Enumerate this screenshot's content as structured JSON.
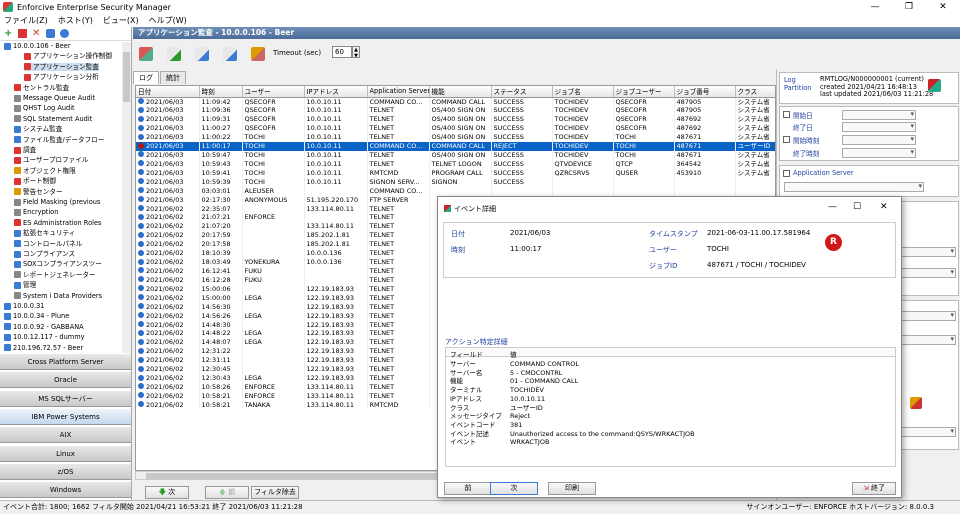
{
  "window": {
    "title": "Enforcive Enterprise Security Manager",
    "controls": [
      "—",
      "❐",
      "✕"
    ]
  },
  "menu": [
    "ファイル(Z)",
    "ホスト(Y)",
    "ビュー(X)",
    "ヘルプ(W)"
  ],
  "tree": {
    "items": [
      {
        "label": "10.0.0.106 - Beer",
        "level": 0,
        "color": "#3a7bd5"
      },
      {
        "label": "アプリケーション操作制御",
        "level": 2,
        "color": "#d33"
      },
      {
        "label": "アプリケーション監査",
        "level": 2,
        "color": "#d33"
      },
      {
        "label": "アプリケーション分析",
        "level": 2,
        "color": "#d33"
      },
      {
        "label": "セントラル監査",
        "level": 1,
        "color": "#d33"
      },
      {
        "label": "Message Queue Audit",
        "level": 1,
        "color": "#888"
      },
      {
        "label": "QHST Log Audit",
        "level": 1,
        "color": "#888"
      },
      {
        "label": "SQL Statement Audit",
        "level": 1,
        "color": "#888"
      },
      {
        "label": "システム監査",
        "level": 1,
        "color": "#3a7bd5"
      },
      {
        "label": "ファイル監査/データフロー",
        "level": 1,
        "color": "#3a7bd5"
      },
      {
        "label": "調査",
        "level": 1,
        "color": "#d33"
      },
      {
        "label": "ユーザープロファイル",
        "level": 1,
        "color": "#d33"
      },
      {
        "label": "オブジェクト権限",
        "level": 1,
        "color": "#d90"
      },
      {
        "label": "ポート制御",
        "level": 1,
        "color": "#d33"
      },
      {
        "label": "警告センター",
        "level": 1,
        "color": "#d90"
      },
      {
        "label": "Field Masking (previous",
        "level": 1,
        "color": "#888"
      },
      {
        "label": "Encryption",
        "level": 1,
        "color": "#888"
      },
      {
        "label": "ES Administration Roles",
        "level": 1,
        "color": "#d33"
      },
      {
        "label": "拡張セキュリティ",
        "level": 1,
        "color": "#3a7bd5"
      },
      {
        "label": "コントロールパネル",
        "level": 1,
        "color": "#3a7bd5"
      },
      {
        "label": "コンプライアンス",
        "level": 1,
        "color": "#3a7bd5"
      },
      {
        "label": "SOXコンプライアンスツー",
        "level": 1,
        "color": "#3a7bd5"
      },
      {
        "label": "レポートジェネレーター",
        "level": 1,
        "color": "#888"
      },
      {
        "label": "管理",
        "level": 1,
        "color": "#3a7bd5"
      },
      {
        "label": "System i Data Providers",
        "level": 1,
        "color": "#888"
      },
      {
        "label": "10.0.0.31",
        "level": 0,
        "color": "#3a7bd5"
      },
      {
        "label": "10.0.0.34 - Plune",
        "level": 0,
        "color": "#3a7bd5"
      },
      {
        "label": "10.0.0.92 - GABBANA",
        "level": 0,
        "color": "#3a7bd5"
      },
      {
        "label": "10.0.12.117 - dummy",
        "level": 0,
        "color": "#3a7bd5"
      },
      {
        "label": "210.196.72.57 - Beer",
        "level": 0,
        "color": "#3a7bd5"
      }
    ]
  },
  "nav_buttons": [
    {
      "label": "Cross Platform Server",
      "active": false
    },
    {
      "label": "Oracle",
      "active": false
    },
    {
      "label": "MS SQLサーバー",
      "active": false
    },
    {
      "label": "IBM Power Systems",
      "active": true
    },
    {
      "label": "AIX",
      "active": false
    },
    {
      "label": "Linux",
      "active": false
    },
    {
      "label": "z/OS",
      "active": false
    },
    {
      "label": "Windows",
      "active": false
    }
  ],
  "main": {
    "header": "アプリケーション監査 - 10.0.0.106 - Beer",
    "timeout_label": "Timeout (sec)",
    "timeout_value": "60",
    "tabs": [
      "ログ",
      "統計"
    ],
    "columns": [
      "日付",
      "時刻",
      "ユーザー",
      "IPアドレス",
      "Application Server",
      "機能",
      "ステータス",
      "ジョブ名",
      "ジョブユーザー",
      "ジョブ番号",
      "クラス"
    ],
    "rows": [
      [
        "2021/06/03",
        "11:09:42",
        "QSECOFR",
        "10.0.10.11",
        "COMMAND CO...",
        "COMMAND CALL",
        "SUCCESS",
        "TOCHIDEV",
        "QSECOFR",
        "487905",
        "システム省"
      ],
      [
        "2021/06/03",
        "11:09:36",
        "QSECOFR",
        "10.0.10.11",
        "TELNET",
        "OS/400 SIGN ON",
        "SUCCESS",
        "TOCHIDEV",
        "QSECOFR",
        "487905",
        "システム省"
      ],
      [
        "2021/06/03",
        "11:09:31",
        "QSECOFR",
        "10.0.10.11",
        "TELNET",
        "OS/400 SIGN ON",
        "SUCCESS",
        "TOCHIDEV",
        "QSECOFR",
        "487692",
        "システム省"
      ],
      [
        "2021/06/03",
        "11:00:27",
        "QSECOFR",
        "10.0.10.11",
        "TELNET",
        "OS/400 SIGN ON",
        "SUCCESS",
        "TOCHIDEV",
        "QSECOFR",
        "487692",
        "システム省"
      ],
      [
        "2021/06/03",
        "11:00:22",
        "TOCHI",
        "10.0.10.11",
        "TELNET",
        "OS/400 SIGN ON",
        "SUCCESS",
        "TOCHIDEV",
        "TOCHI",
        "487671",
        "システム省"
      ],
      [
        "2021/06/03",
        "11:00:17",
        "TOCHI",
        "10.0.10.11",
        "COMMAND CO...",
        "COMMAND CALL",
        "REJECT",
        "TOCHIDEV",
        "TOCHI",
        "487671",
        "ユーザーID"
      ],
      [
        "2021/06/03",
        "10:59:47",
        "TOCHI",
        "10.0.10.11",
        "TELNET",
        "OS/400 SIGN ON",
        "SUCCESS",
        "TOCHIDEV",
        "TOCHI",
        "487671",
        "システム省"
      ],
      [
        "2021/06/03",
        "10:59:43",
        "TOCHI",
        "10.0.10.11",
        "TELNET",
        "TELNET LOGON",
        "SUCCESS",
        "QTVDEVICE",
        "QTCP",
        "364542",
        "システム省"
      ],
      [
        "2021/06/03",
        "10:59:41",
        "TOCHI",
        "10.0.10.11",
        "RMTCMD",
        "PROGRAM CALL",
        "SUCCESS",
        "QZRCSRVS",
        "QUSER",
        "453910",
        "システム省"
      ],
      [
        "2021/06/03",
        "10:59:39",
        "TOCHI",
        "10.0.10.11",
        "SIGNON SERV...",
        "SIGNON",
        "SUCCESS",
        "",
        "",
        "",
        ""
      ],
      [
        "2021/06/03",
        "03:03:01",
        "ALEUSER",
        "",
        "COMMAND CO...",
        "",
        "",
        "",
        "",
        "",
        ""
      ],
      [
        "2021/06/03",
        "02:17:30",
        "ANONYMOUS",
        "51.195.220.170",
        "FTP SERVER",
        "",
        "",
        "",
        "",
        "",
        ""
      ],
      [
        "2021/06/02",
        "22:35:07",
        "",
        "133.114.80.11",
        "TELNET",
        "",
        "",
        "",
        "",
        "",
        ""
      ],
      [
        "2021/06/02",
        "21:07:21",
        "ENFORCE",
        "",
        "TELNET",
        "",
        "",
        "",
        "",
        "",
        ""
      ],
      [
        "2021/06/02",
        "21:07:20",
        "",
        "133.114.80.11",
        "TELNET",
        "",
        "",
        "",
        "",
        "",
        ""
      ],
      [
        "2021/06/02",
        "20:17:59",
        "",
        "185.202.1.81",
        "TELNET",
        "",
        "",
        "",
        "",
        "",
        ""
      ],
      [
        "2021/06/02",
        "20:17:58",
        "",
        "185.202.1.81",
        "TELNET",
        "",
        "",
        "",
        "",
        "",
        ""
      ],
      [
        "2021/06/02",
        "18:10:39",
        "",
        "10.0.0.136",
        "TELNET",
        "",
        "",
        "",
        "",
        "",
        ""
      ],
      [
        "2021/06/02",
        "18:03:49",
        "YONEKURA",
        "10.0.0.136",
        "TELNET",
        "",
        "",
        "",
        "",
        "",
        ""
      ],
      [
        "2021/06/02",
        "16:12:41",
        "FUKU",
        "",
        "TELNET",
        "",
        "",
        "",
        "",
        "",
        ""
      ],
      [
        "2021/06/02",
        "16:12:28",
        "FUKU",
        "",
        "TELNET",
        "",
        "",
        "",
        "",
        "",
        ""
      ],
      [
        "2021/06/02",
        "15:00:06",
        "",
        "122.19.183.93",
        "TELNET",
        "",
        "",
        "",
        "",
        "",
        ""
      ],
      [
        "2021/06/02",
        "15:00:00",
        "LEGA",
        "122.19.183.93",
        "TELNET",
        "",
        "",
        "",
        "",
        "",
        ""
      ],
      [
        "2021/06/02",
        "14:56:30",
        "",
        "122.19.183.93",
        "TELNET",
        "",
        "",
        "",
        "",
        "",
        ""
      ],
      [
        "2021/06/02",
        "14:56:26",
        "LEGA",
        "122.19.183.93",
        "TELNET",
        "",
        "",
        "",
        "",
        "",
        ""
      ],
      [
        "2021/06/02",
        "14:48:30",
        "",
        "122.19.183.93",
        "TELNET",
        "",
        "",
        "",
        "",
        "",
        ""
      ],
      [
        "2021/06/02",
        "14:48:22",
        "LEGA",
        "122.19.183.93",
        "TELNET",
        "",
        "",
        "",
        "",
        "",
        ""
      ],
      [
        "2021/06/02",
        "14:48:07",
        "LEGA",
        "122.19.183.93",
        "TELNET",
        "",
        "",
        "",
        "",
        "",
        ""
      ],
      [
        "2021/06/02",
        "12:31:22",
        "",
        "122.19.183.93",
        "TELNET",
        "",
        "",
        "",
        "",
        "",
        ""
      ],
      [
        "2021/06/02",
        "12:31:11",
        "",
        "122.19.183.93",
        "TELNET",
        "",
        "",
        "",
        "",
        "",
        ""
      ],
      [
        "2021/06/02",
        "12:30:45",
        "",
        "122.19.183.93",
        "TELNET",
        "",
        "",
        "",
        "",
        "",
        ""
      ],
      [
        "2021/06/02",
        "12:30:43",
        "LEGA",
        "122.19.183.93",
        "TELNET",
        "",
        "",
        "",
        "",
        "",
        ""
      ],
      [
        "2021/06/02",
        "10:58:26",
        "ENFORCE",
        "133.114.80.11",
        "TELNET",
        "",
        "",
        "",
        "",
        "",
        ""
      ],
      [
        "2021/06/02",
        "10:58:21",
        "ENFORCE",
        "133.114.80.11",
        "TELNET",
        "",
        "",
        "",
        "",
        "",
        ""
      ],
      [
        "2021/06/02",
        "10:58:21",
        "TANAKA",
        "133.114.80.11",
        "RMTCMD",
        "",
        "",
        "",
        "",
        "",
        ""
      ]
    ],
    "next_label": "次",
    "prev_label": "前",
    "filter_clear_label": "フィルタ除去"
  },
  "filter": {
    "log_partition_label": "Log Partition",
    "log_partition_value": "RMTLOG/N000000001 (current)",
    "created": "created 2021/04/21 16:48:13",
    "last_updated": "last updated 2021/06/03 11:21:28",
    "start_date": "開始日",
    "end_date": "終了日",
    "start_time": "開始時刻",
    "end_time": "終了時刻",
    "app_server": "Application Server"
  },
  "dialog": {
    "title": "イベント詳細",
    "date_label": "日付",
    "date_value": "2021/06/03",
    "timestamp_label": "タイムスタンプ",
    "timestamp_value": "2021-06-03-11.00.17.581964",
    "time_label": "時刻",
    "time_value": "11:00:17",
    "user_label": "ユーザー",
    "user_value": "TOCHI",
    "jobid_label": "ジョブID",
    "jobid_value": "487671 / TOCHI / TOCHIDEV",
    "badge": "R",
    "section": "アクション特定詳細",
    "col_field": "フィールド",
    "col_value": "値",
    "details": [
      {
        "f": "サーバー",
        "v": "COMMAND CONTROL"
      },
      {
        "f": "サーバー名",
        "v": "5 - CMDCONTRL"
      },
      {
        "f": "機能",
        "v": "01 - COMMAND CALL"
      },
      {
        "f": "ターミナル",
        "v": "TOCHIDEV"
      },
      {
        "f": "IPアドレス",
        "v": "10.0.10.11"
      },
      {
        "f": "クラス",
        "v": "ユーザーID"
      },
      {
        "f": "メッセージタイプ",
        "v": "Reject"
      },
      {
        "f": "イベントコード",
        "v": "381"
      },
      {
        "f": "イベント記述",
        "v": "Unauthorized access to the command:QSYS/WRKACTJOB"
      },
      {
        "f": "イベント",
        "v": "WRKACTJOB"
      }
    ],
    "btn_prev": "前",
    "btn_next": "次",
    "btn_print": "印刷",
    "btn_close": "終了"
  },
  "status": {
    "left": "イベント合計: 1800; 1662 フィルタ開始 2021/04/21 16:53:21 終了 2021/06/03 11:21:28",
    "right": "サインオンユーザー: ENFORCE ホストバージョン: 8.0.0.3"
  }
}
